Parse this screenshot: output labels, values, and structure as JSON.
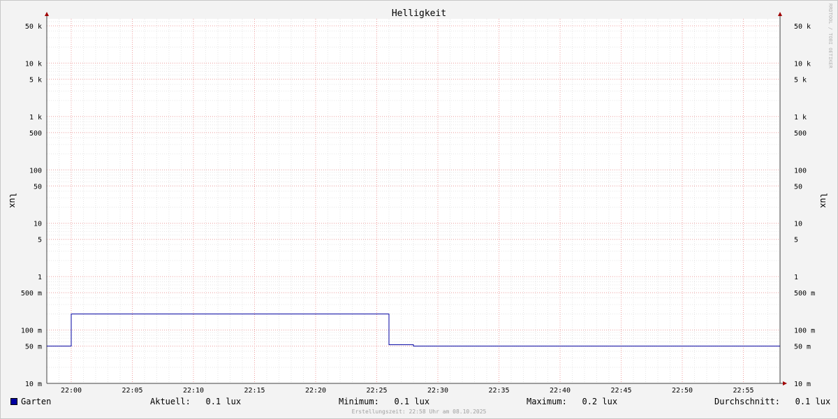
{
  "chart_data": {
    "type": "line",
    "title": "Helligkeit",
    "ylabel": "lux",
    "y_scale": "log",
    "ylim": [
      10,
      70000
    ],
    "y_ticks": [
      {
        "value": 10,
        "label": "10 m"
      },
      {
        "value": 50,
        "label": "50 m"
      },
      {
        "value": 100,
        "label": "100 m"
      },
      {
        "value": 500,
        "label": "500 m"
      },
      {
        "value": 1000,
        "label": "1"
      },
      {
        "value": 5000,
        "label": "5"
      },
      {
        "value": 10000,
        "label": "10"
      },
      {
        "value": 50000,
        "label": "50"
      },
      {
        "value": 100000,
        "label": "100"
      },
      {
        "value": 500000,
        "label": "500"
      },
      {
        "value": 1000000,
        "label": "1 k"
      },
      {
        "value": 5000000,
        "label": "5 k"
      },
      {
        "value": 10000000,
        "label": "10 k"
      },
      {
        "value": 50000000,
        "label": "50 k"
      }
    ],
    "xlim": [
      "21:58",
      "23:58"
    ],
    "x_ticks": [
      "22:00",
      "22:05",
      "22:10",
      "22:15",
      "22:20",
      "22:25",
      "22:30",
      "22:35",
      "22:40",
      "22:45",
      "22:50",
      "22:55"
    ],
    "grid": true,
    "legend_position": "bottom",
    "series": [
      {
        "name": "Garten",
        "color": "#0000a0",
        "points": [
          {
            "time": "21:58",
            "value": 50
          },
          {
            "time": "22:00",
            "value": 50
          },
          {
            "time": "22:00",
            "value": 200
          },
          {
            "time": "22:26",
            "value": 200
          },
          {
            "time": "22:26",
            "value": 53
          },
          {
            "time": "22:28",
            "value": 53
          },
          {
            "time": "22:28",
            "value": 50
          },
          {
            "time": "22:58",
            "value": 50
          }
        ]
      }
    ]
  },
  "legend": {
    "series_name": "Garten",
    "series_color": "#0000a0",
    "aktuell": "Aktuell:   0.1 lux",
    "minimum": "Minimum:   0.1 lux",
    "maximum": "Maximum:   0.2 lux",
    "durchschnitt": "Durchschnitt:   0.1 lux"
  },
  "watermark": "RRDTOOL / TOBI OETIKER",
  "footer": "Erstellungszeit: 22:58 Uhr am 08.10.2025"
}
